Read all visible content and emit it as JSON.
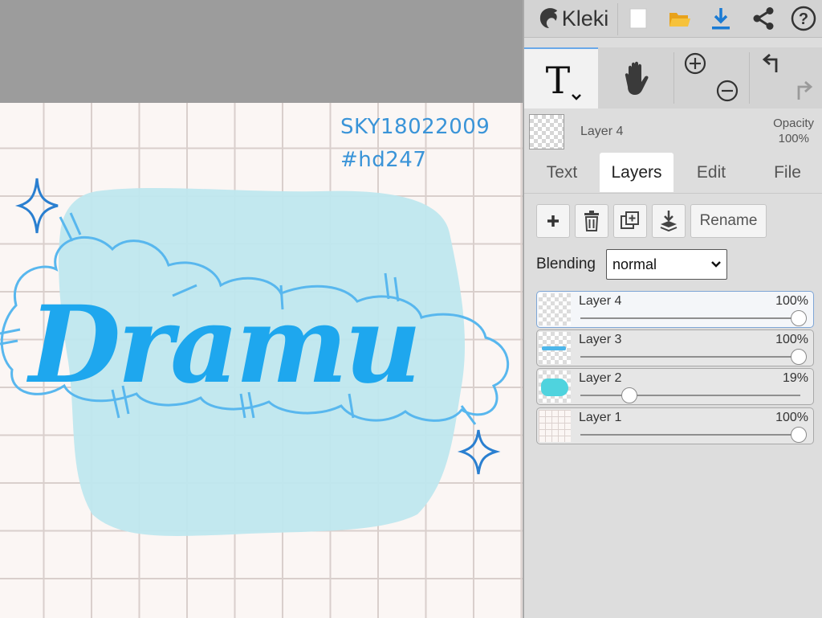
{
  "app": {
    "name": "Kleki"
  },
  "toolbar": {
    "icons": [
      "new-image-icon",
      "open-folder-icon",
      "download-icon",
      "share-icon",
      "help-icon"
    ],
    "accent_color": "#1a7bd4",
    "folder_color": "#f0b429"
  },
  "tools": {
    "active_tool": "text-tool",
    "items": [
      "text-tool",
      "hand-tool",
      "zoom-in",
      "zoom-out",
      "undo",
      "redo"
    ],
    "text_tool_glyph": "T"
  },
  "current_layer": {
    "name": "Layer 4",
    "opacity_label": "Opacity",
    "opacity_value": "100%"
  },
  "tabs": [
    {
      "label": "Text",
      "active": false
    },
    {
      "label": "Layers",
      "active": true
    },
    {
      "label": "Edit",
      "active": false
    },
    {
      "label": "File",
      "active": false
    }
  ],
  "layer_actions": {
    "rename_label": "Rename",
    "icons": [
      "add-layer-icon",
      "delete-layer-icon",
      "duplicate-layer-icon",
      "merge-down-icon"
    ]
  },
  "blending": {
    "label": "Blending",
    "value": "normal"
  },
  "layers": [
    {
      "name": "Layer 4",
      "opacity": "100%",
      "opacity_fraction": 1.0,
      "selected": true
    },
    {
      "name": "Layer 3",
      "opacity": "100%",
      "opacity_fraction": 1.0,
      "selected": false
    },
    {
      "name": "Layer 2",
      "opacity": "19%",
      "opacity_fraction": 0.19,
      "selected": false
    },
    {
      "name": "Layer 1",
      "opacity": "100%",
      "opacity_fraction": 1.0,
      "selected": false
    }
  ],
  "artwork": {
    "text_line1": "SKY18022009",
    "text_line2": "#hd247",
    "lettering": "Dramu",
    "lettering_color": "#1ea7ee",
    "blob_color": "#bfe7ee",
    "outline_color": "#58b7ee"
  }
}
